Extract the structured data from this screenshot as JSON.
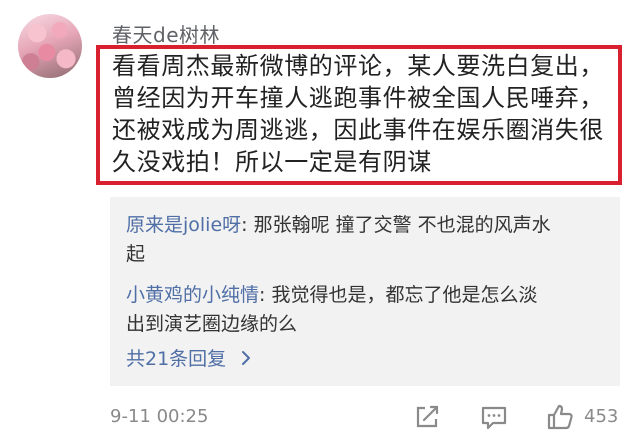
{
  "comment": {
    "username": "春天de树林",
    "text": "看看周杰最新微博的评论，某人要洗白复出，\n曾经因为开车撞人逃跑事件被全国人民唾弃，\n还被戏成为周逃逃，因此事件在娱乐圈消失很\n久没戏拍！所以一定是有阴谋",
    "timestamp": "9-11 00:25",
    "like_count": "453"
  },
  "replies": [
    {
      "name": "原来是jolie呀",
      "text": ": 那张翰呢 撞了交警 不也混的风声水\n起"
    },
    {
      "name": "小黄鸡的小纯情",
      "text": ": 我觉得也是，都忘了他是怎么淡\n出到演艺圈边缘的么"
    }
  ],
  "more_replies": "共21条回复",
  "icons": {
    "share": "share-icon",
    "reply": "comment-icon",
    "like": "thumbs-up-icon",
    "more": "chevron-right-icon"
  },
  "colors": {
    "highlight_border": "#d8202f",
    "reply_name": "#4f6fa6",
    "reply_background": "#f2f2f2",
    "meta_gray": "#8a8a8a"
  }
}
